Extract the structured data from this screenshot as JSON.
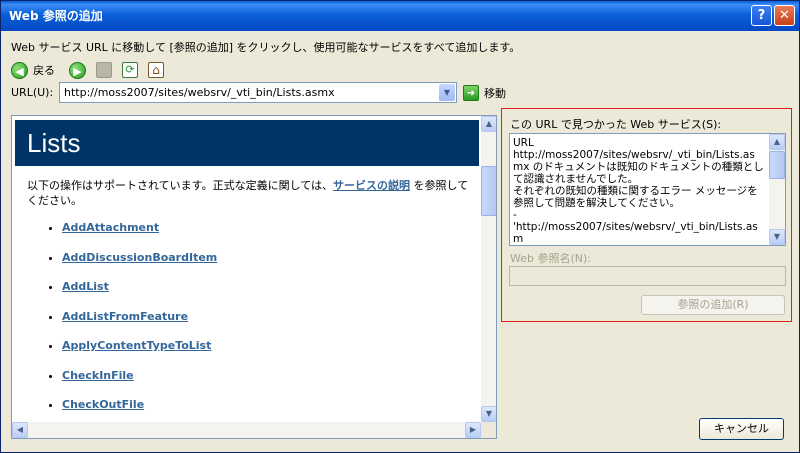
{
  "window": {
    "title": "Web 参照の追加",
    "help_glyph": "?",
    "close_glyph": "✕"
  },
  "instructions": "Web サービス URL に移動して [参照の追加] をクリックし、使用可能なサービスをすべて追加します。",
  "toolbar": {
    "back_label": "戻る",
    "back_icon": "back-arrow-icon",
    "forward_icon": "forward-arrow-icon",
    "stop_icon": "stop-icon",
    "refresh_icon": "refresh-icon",
    "home_icon": "home-icon"
  },
  "url": {
    "label": "URL(U):",
    "value": "http://moss2007/sites/websrv/_vti_bin/Lists.asmx",
    "go_label": "移動"
  },
  "browser": {
    "heading": "Lists",
    "description_before": "以下の操作はサポートされています。正式な定義に関しては、",
    "description_link": "サービスの説明",
    "description_after": " を参照してください。",
    "operations": [
      "AddAttachment",
      "AddDiscussionBoardItem",
      "AddList",
      "AddListFromFeature",
      "ApplyContentTypeToList",
      "CheckInFile",
      "CheckOutFile"
    ]
  },
  "found_panel": {
    "label": "この URL で見つかった Web サービス(S):",
    "text": "URL\nhttp://moss2007/sites/websrv/_vti_bin/Lists.asmx のドキュメントは既知のドキュメントの種類として認識されませんでした。\nそれぞれの既知の種類に関するエラー メッセージを参照して問題を解決してください。\n-\n'http://moss2007/sites/websrv/_vti_bin/Lists.asm",
    "ref_name_label": "Web 参照名(N):",
    "ref_name_value": "",
    "add_button": "参照の追加(R)"
  },
  "cancel_button": "キャンセル",
  "colors": {
    "title_bar": "#0a5fd8",
    "header_bg": "#003366",
    "link": "#336699",
    "highlight_border": "#e02020"
  }
}
